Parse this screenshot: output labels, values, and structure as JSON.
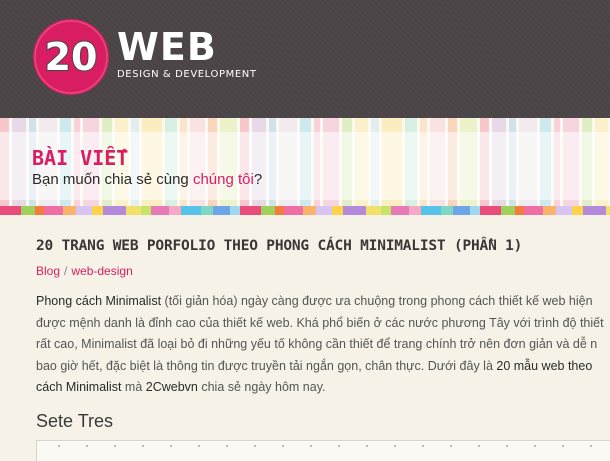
{
  "logo": {
    "mark_text": "20",
    "word": "WEB",
    "tagline": "DESIGN & DEVELOPMENT"
  },
  "banner": {
    "title": "BÀI VIẾT",
    "subtitle_prefix": "Bạn muốn chia sẻ cùng ",
    "subtitle_link": "chúng tôi",
    "subtitle_suffix": "?"
  },
  "post": {
    "title": "20 TRANG WEB PORFOLIO THEO PHONG CÁCH MINIMALIST (PHẦN 1)",
    "breadcrumb": [
      "Blog",
      "web-design"
    ],
    "breadcrumb_sep": "/",
    "para": {
      "l1_a": "Phong cách Minimalist",
      "l1_b": " (tối giản hóa) ngày càng được ưa chuộng trong phong cách thiết kế web hiện",
      "l2": "được mệnh danh là đỉnh cao của thiết kế web. Khá phổ biến ở các nước phương Tây với trình độ thiết",
      "l3": "rất cao, Minimalist đã loại bỏ đi những yếu tố không cần thiết để trang chính trở nên đơn giản và dễ n",
      "l4_a": "bao giờ hết, đặc biệt là thông tin được truyền tải ngắn gọn, chân thực. Dưới đây là ",
      "l4_b": "20 mẫu web theo",
      "l5_a": "cách Minimalist",
      "l5_b": " mà ",
      "l5_c": "2Cwebvn",
      "l5_d": " chia sẻ ngày hôm nay."
    },
    "section_heading": "Sete Tres"
  },
  "colors": {
    "accent": "#d91d63",
    "header_bg": "#4b4447",
    "page_bg": "#f6f2e8"
  }
}
